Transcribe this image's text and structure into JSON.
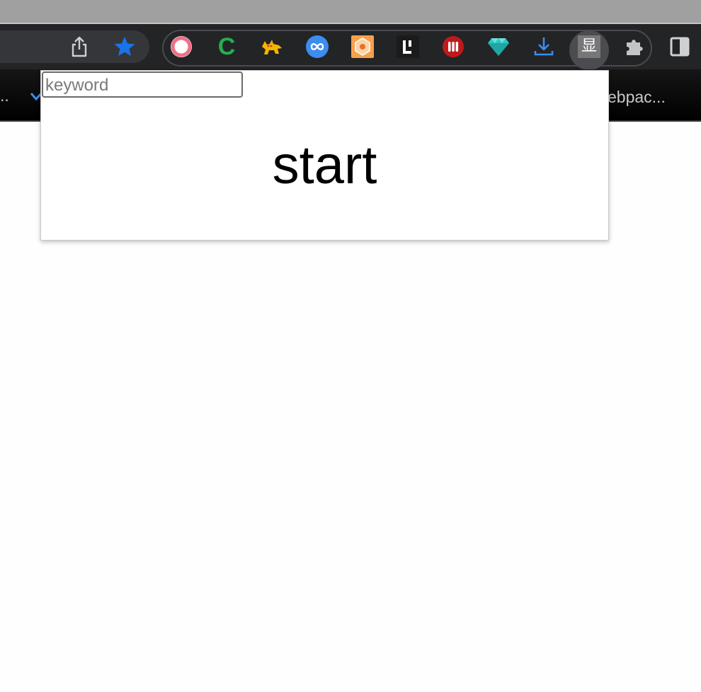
{
  "toolbar": {
    "share_icon": "share-icon",
    "bookmark_star_icon": "star-icon",
    "extensions": [
      {
        "name": "pink-ring-extension-icon",
        "color": "#f06f86"
      },
      {
        "name": "green-c-extension-icon",
        "label": "C",
        "color": "#22b14c"
      },
      {
        "name": "tampermonkey-cat-extension-icon",
        "color": "#f5b400"
      },
      {
        "name": "blue-link-extension-icon",
        "color": "#3d8cf0"
      },
      {
        "name": "orange-hexagon-extension-icon",
        "color": "#f6a04d"
      },
      {
        "name": "black-l-extension-icon",
        "color": "#1b1b1b"
      },
      {
        "name": "red-bars-extension-icon",
        "color": "#c0191c"
      },
      {
        "name": "teal-gem-extension-icon",
        "color": "#2fc6c2"
      },
      {
        "name": "download-extension-icon",
        "color": "#3d8cf0"
      },
      {
        "name": "display-extension-icon",
        "label": "显",
        "color": "#777777"
      }
    ],
    "puzzle_icon": "extensions-puzzle-icon",
    "side_panel_icon": "side-panel-icon"
  },
  "bookmarks": {
    "left_label": "..",
    "right_label": "ebpac..."
  },
  "popup": {
    "search": {
      "placeholder": "keyword",
      "value": ""
    },
    "start_label": "start"
  }
}
